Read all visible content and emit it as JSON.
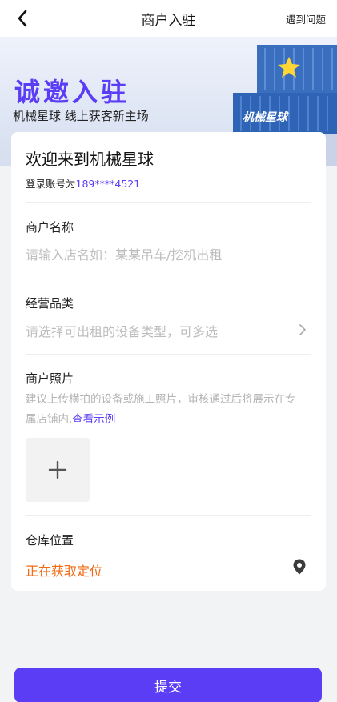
{
  "nav": {
    "title": "商户入驻",
    "help_label": "遇到问题"
  },
  "banner": {
    "title": "诚邀入驻",
    "subtitle": "机械星球 线上获客新主场",
    "art_logo_text": "机械星球"
  },
  "card": {
    "welcome": "欢迎来到机械星球",
    "account_prefix": "登录账号为",
    "account_phone": "189****4521"
  },
  "form": {
    "shop_name": {
      "label": "商户名称",
      "placeholder": "请输入店名如：某某吊车/挖机出租",
      "value": ""
    },
    "category": {
      "label": "经营品类",
      "placeholder": "请选择可出租的设备类型，可多选"
    },
    "photos": {
      "label": "商户照片",
      "hint": "建议上传横拍的设备或施工照片，审核通过后将展示在专属店铺内,",
      "example_link": "查看示例"
    },
    "location": {
      "label": "仓库位置",
      "status": "正在获取定位"
    }
  },
  "submit_label": "提交",
  "colors": {
    "brand": "#5b3df5",
    "locating": "#f26a11",
    "placeholder": "#bdbdbd"
  },
  "icons": [
    "back-icon",
    "chevron-right-icon",
    "plus-icon",
    "location-pin-icon"
  ]
}
